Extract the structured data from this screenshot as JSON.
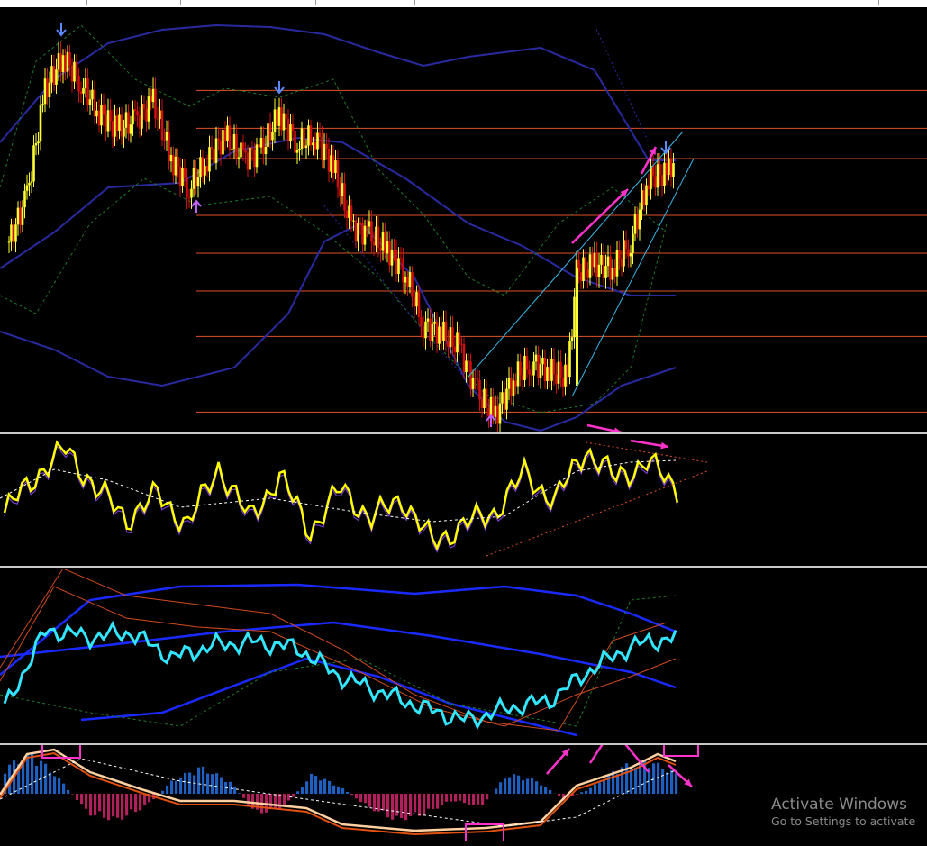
{
  "window": {
    "watermark_title": "Activate Windows",
    "watermark_subtitle": "Go to Settings to activate"
  },
  "colors": {
    "background": "#000000",
    "candle_up": "#ffff33",
    "candle_down": "#d01010",
    "level_line": "#e0502a",
    "band_blue": "#2a2aa0",
    "band_green": "#1f7a2a",
    "channel": "#39b7e8",
    "annotation": "#ff33cc",
    "osc_line": "#ffff00",
    "osc_sig": "#7a3ccf",
    "rsi_line": "#33e6ff",
    "macd_up": "#1f5fbf",
    "macd_down": "#b0205a",
    "macd_line": "#ffd0a0"
  },
  "icons": [
    "arrow-down-icon",
    "arrow-up-icon"
  ],
  "chart_data": [
    {
      "type": "candlestick",
      "title": "",
      "ylim": [
        0,
        100
      ],
      "x": [
        0,
        100
      ],
      "close_series": [
        {
          "x": 0,
          "y": 48
        },
        {
          "x": 2,
          "y": 60
        },
        {
          "x": 4,
          "y": 88
        },
        {
          "x": 6,
          "y": 97
        },
        {
          "x": 8,
          "y": 90
        },
        {
          "x": 10,
          "y": 82
        },
        {
          "x": 12,
          "y": 78
        },
        {
          "x": 14,
          "y": 80
        },
        {
          "x": 16,
          "y": 85
        },
        {
          "x": 18,
          "y": 70
        },
        {
          "x": 20,
          "y": 62
        },
        {
          "x": 22,
          "y": 70
        },
        {
          "x": 24,
          "y": 76
        },
        {
          "x": 26,
          "y": 70
        },
        {
          "x": 28,
          "y": 72
        },
        {
          "x": 30,
          "y": 82
        },
        {
          "x": 32,
          "y": 74
        },
        {
          "x": 34,
          "y": 76
        },
        {
          "x": 36,
          "y": 68
        },
        {
          "x": 38,
          "y": 52
        },
        {
          "x": 40,
          "y": 50
        },
        {
          "x": 42,
          "y": 46
        },
        {
          "x": 44,
          "y": 40
        },
        {
          "x": 46,
          "y": 26
        },
        {
          "x": 48,
          "y": 24
        },
        {
          "x": 50,
          "y": 20
        },
        {
          "x": 52,
          "y": 8
        },
        {
          "x": 54,
          "y": 2
        },
        {
          "x": 56,
          "y": 12
        },
        {
          "x": 58,
          "y": 16
        },
        {
          "x": 60,
          "y": 14
        },
        {
          "x": 62,
          "y": 12
        },
        {
          "x": 63,
          "y": 40
        },
        {
          "x": 65,
          "y": 42
        },
        {
          "x": 67,
          "y": 41
        },
        {
          "x": 69,
          "y": 48
        },
        {
          "x": 71,
          "y": 65
        },
        {
          "x": 73,
          "y": 66
        },
        {
          "x": 74,
          "y": 70
        }
      ],
      "horizontal_levels": [
        88,
        78,
        70,
        55,
        45,
        35,
        23,
        3
      ]
    },
    {
      "type": "line",
      "series": [
        {
          "values": [
            40,
            70,
            92,
            60,
            35,
            55,
            30,
            78,
            35,
            70,
            25,
            60,
            35,
            52,
            15,
            30,
            40,
            72,
            50,
            92,
            68,
            82,
            60
          ]
        }
      ]
    },
    {
      "type": "line",
      "series": [
        {
          "values": [
            20,
            70,
            65,
            68,
            52,
            60,
            62,
            58,
            40,
            30,
            20,
            12,
            20,
            25,
            45,
            60,
            65
          ]
        }
      ]
    },
    {
      "type": "bar",
      "values": [
        4,
        6,
        2,
        -3,
        -4,
        -2,
        2,
        4,
        2,
        -3,
        -2,
        3,
        1,
        -2,
        -4,
        -3,
        -1,
        -2,
        3,
        2,
        -1,
        1,
        4,
        5,
        3
      ]
    }
  ]
}
